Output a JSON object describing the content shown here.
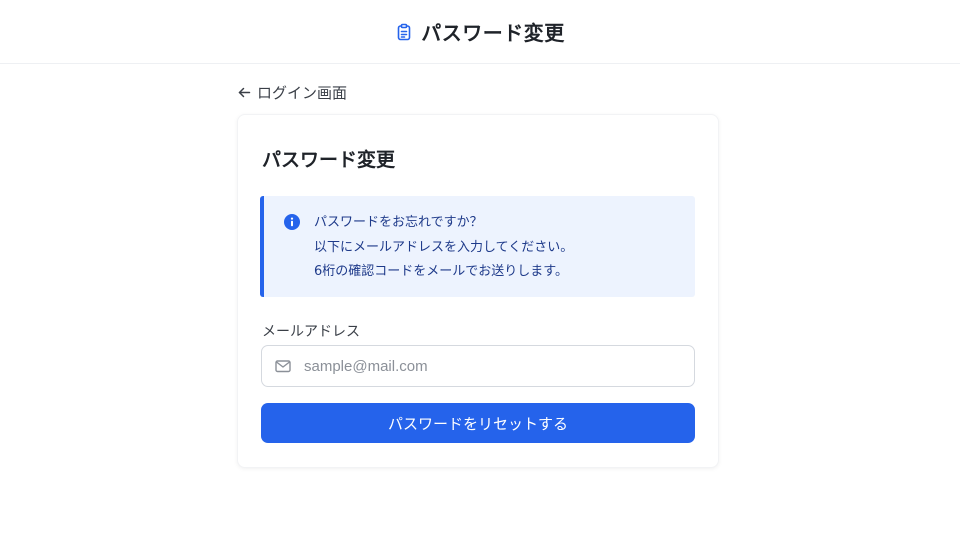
{
  "header": {
    "title": "パスワード変更",
    "icon": "clipboard-icon"
  },
  "back_link": {
    "label": "ログイン画面",
    "icon": "arrow-left-icon"
  },
  "card": {
    "title": "パスワード変更",
    "info": {
      "icon": "info-circle-icon",
      "lines": [
        "パスワードをお忘れですか？",
        "以下にメールアドレスを入力してください。",
        "6桁の確認コードをメールでお送りします。"
      ]
    },
    "email_field": {
      "label": "メールアドレス",
      "placeholder": "sample@mail.com",
      "value": "",
      "icon": "mail-icon"
    },
    "submit_label": "パスワードをリセットする"
  },
  "colors": {
    "accent": "#2563eb",
    "info_bg": "#edf3fe",
    "info_text": "#1e3a8a"
  }
}
